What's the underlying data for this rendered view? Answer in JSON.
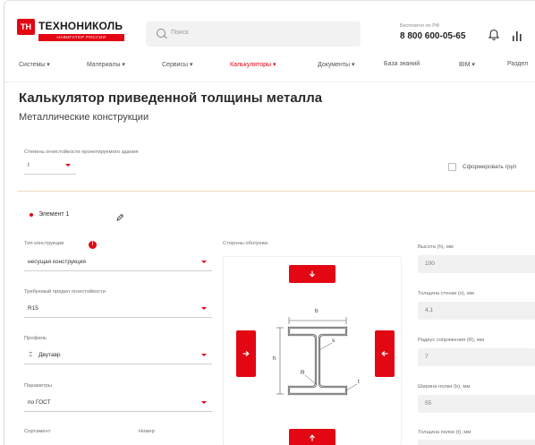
{
  "header": {
    "logo_text": "ТЕХНОНИКОЛЬ",
    "logo_sub": "НАВИГАТОР РОССИИ",
    "search_placeholder": "Поиск",
    "phone_caption": "Бесплатно по РФ",
    "phone_number": "8 800 600-05-65"
  },
  "nav": {
    "items": [
      "Системы ▾",
      "Материалы ▾",
      "Сервисы ▾",
      "Калькуляторы ▾",
      "Документы ▾",
      "База знаний",
      "BIM ▾",
      "Раздел"
    ],
    "active_index": 3
  },
  "page": {
    "title": "Калькулятор приведенной толщины металла",
    "subtitle": "Металлические конструкции"
  },
  "fire_resistance_degree": {
    "label": "Степень огнестойкости проектируемого здания",
    "value": "I"
  },
  "group_checkbox": {
    "label": "Сформировать груп",
    "checked": false
  },
  "element": {
    "label": "Элемент 1"
  },
  "construction_type": {
    "label": "Тип конструкции",
    "value": "несущая конструкция"
  },
  "fire_limit": {
    "label": "Требуемый предел огнестойкости",
    "value": "R15"
  },
  "profile": {
    "label": "Профиль",
    "value": "Двутавр"
  },
  "parameters": {
    "label": "Параметры",
    "value": "по ГОСТ"
  },
  "assortment": {
    "label": "Сортамент"
  },
  "number": {
    "label": "Номер"
  },
  "heating_sides": {
    "label": "Стороны обогрева"
  },
  "beam_dims": {
    "b": "b",
    "h": "h",
    "s": "s",
    "r": "R",
    "t": "t"
  },
  "right_fields": [
    {
      "label": "Высота (h), мм",
      "value": "100"
    },
    {
      "label": "Толщина стенки (s), мм",
      "value": "4,1"
    },
    {
      "label": "Радиус сопряжения (R), мм",
      "value": "7"
    },
    {
      "label": "Ширина полки (b), мм",
      "value": "55"
    },
    {
      "label": "Толщина полки (t), мм",
      "value": ""
    }
  ],
  "colors": {
    "accent": "#e30613",
    "divider": "#f0d9bd",
    "readonly_bg": "#f1f1f1"
  }
}
